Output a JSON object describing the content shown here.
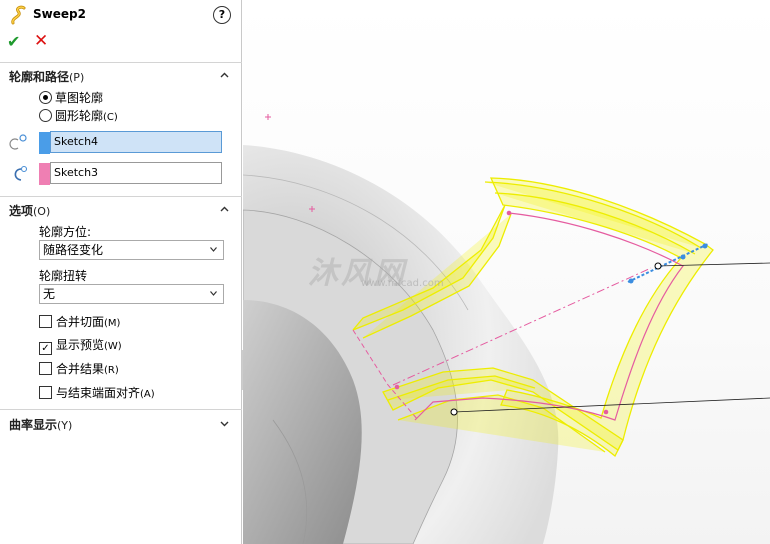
{
  "panel": {
    "title": "Sweep2",
    "help": "?",
    "ok_symbol": "✔",
    "cancel_symbol": "✕",
    "profile_path": {
      "header": "轮廓和路径",
      "header_key": "(P)",
      "radio_sketch_profile": "草图轮廓",
      "radio_circular_profile": "圆形轮廓",
      "radio_circular_key": "(C)",
      "profile_value": "Sketch4",
      "path_value": "Sketch3",
      "profile_color": "#4a9de8",
      "path_color": "#ef7fb3"
    },
    "options": {
      "header": "选项",
      "header_key": "(O)",
      "orientation_label": "轮廓方位:",
      "orientation_value": "随路径变化",
      "twist_label": "轮廓扭转",
      "twist_value": "无",
      "merge_faces": "合并切面",
      "merge_faces_key": "(M)",
      "show_preview": "显示预览",
      "show_preview_key": "(W)",
      "merge_result": "合并结果",
      "merge_result_key": "(R)",
      "align_end_faces": "与结束端面对齐",
      "align_end_faces_key": "(A)"
    },
    "curvature": {
      "header": "曲率显示",
      "header_key": "(Y)"
    }
  },
  "viewport": {
    "watermark": "沐风网",
    "watermark_url": "www.mfcad.com",
    "preview_color": "#f2f200",
    "path_line_color": "#e55ca0",
    "handle_color": "#3b8de0"
  }
}
